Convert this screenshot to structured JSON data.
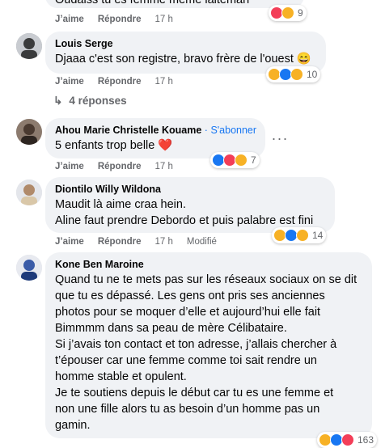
{
  "top_comment": {
    "text": "Oudaiss tu es femme même laiteman",
    "actions": {
      "like": "J’aime",
      "reply": "Répondre",
      "time": "17 h"
    },
    "reaction_count": "9"
  },
  "comments": [
    {
      "author": "Louis Serge",
      "text": "Djaaa c'est son registre, bravo frère de l'ouest 😄",
      "like": "J’aime",
      "reply": "Répondre",
      "time": "17 h",
      "reaction_count": "10",
      "replies_label": "4 réponses"
    },
    {
      "author": "Ahou Marie Christelle Kouame",
      "separator": "·",
      "follow": "S'abonner",
      "text": "5 enfants trop belle ❤️",
      "like": "J’aime",
      "reply": "Répondre",
      "time": "17 h",
      "reaction_count": "7"
    },
    {
      "author": "Diontilo Willy Wildona",
      "lines": [
        "Maudit là aime craa hein.",
        "Aline faut prendre Debordo et puis palabre est fini"
      ],
      "like": "J’aime",
      "reply": "Répondre",
      "time": "17 h",
      "edited": "Modifié",
      "reaction_count": "14"
    },
    {
      "author": "Kone Ben Maroine",
      "lines": [
        "Quand tu ne te mets pas sur les réseaux sociaux on se dit",
        "que tu es dépassé. Les gens ont pris ses anciennes",
        "photos pour se moquer d’elle et aujourd’hui elle fait",
        "Bimmmm dans sa peau de mère Célibataire.",
        "Si j’avais ton contact et ton adresse, j’allais chercher à",
        "t’épouser car une femme comme toi sait rendre un",
        "homme stable et opulent.",
        "Je te soutiens depuis le début car tu es une femme et",
        "non une fille alors tu as besoin d’un homme pas un",
        "gamin."
      ],
      "reaction_count": "163"
    }
  ],
  "icons": [
    "haha-reaction-icon",
    "like-reaction-icon",
    "love-reaction-icon",
    "care-reaction-icon",
    "more-options-icon",
    "reply-arrow-icon"
  ],
  "colors": {
    "bubble": "#f0f2f5",
    "link": "#1877f2",
    "meta": "#65676b",
    "like": "#1877f2",
    "love": "#f33e58",
    "haha": "#f7b125"
  }
}
